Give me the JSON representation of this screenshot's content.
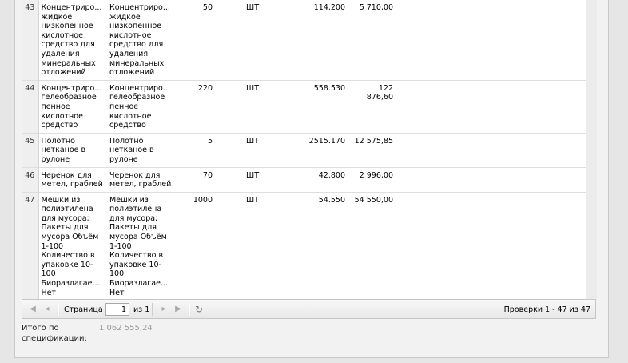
{
  "table": {
    "rows": [
      {
        "num": "43",
        "name": "Концентриро... жидкое низкопенное кислотное средство для удаления минеральных отложений",
        "name2": "Концентриро... жидкое низкопенное кислотное средство для удаления минеральных отложений",
        "qty": "50",
        "unit": "ШТ",
        "price": "114.200",
        "sum": "5 710,00"
      },
      {
        "num": "44",
        "name": "Концентриро... гелеобразное пенное кислотное средство",
        "name2": "Концентриро... гелеобразное пенное кислотное средство",
        "qty": "220",
        "unit": "ШТ",
        "price": "558.530",
        "sum": "122 876,60"
      },
      {
        "num": "45",
        "name": "Полотно нетканое в рулоне",
        "name2": "Полотно нетканое в рулоне",
        "qty": "5",
        "unit": "ШТ",
        "price": "2515.170",
        "sum": "12 575,85"
      },
      {
        "num": "46",
        "name": "Черенок для метел, граблей",
        "name2": "Черенок для метел, граблей",
        "qty": "70",
        "unit": "ШТ",
        "price": "42.800",
        "sum": "2 996,00"
      },
      {
        "num": "47",
        "name": "Мешки из полиэтилена для мусора; Пакеты для мусора Объём 1-100 Количество в упаковке 10-100 Биоразлагае... Нет",
        "name2": "Мешки из полиэтилена для мусора; Пакеты для мусора Объём 1-100 Количество в упаковке 10-100 Биоразлагае... Нет",
        "qty": "1000",
        "unit": "ШТ",
        "price": "54.550",
        "sum": "54 550,00"
      }
    ]
  },
  "paging": {
    "page_label": "Страница",
    "page_value": "1",
    "of_label": "из 1",
    "display": "Проверки 1 - 47 из 47",
    "icons": {
      "first": "first-page-icon",
      "prev": "prev-page-icon",
      "next": "next-page-icon",
      "last": "last-page-icon",
      "refresh": "refresh-icon"
    }
  },
  "total": {
    "label": "Итого по спецификации:",
    "value": "1 062 555,24"
  }
}
